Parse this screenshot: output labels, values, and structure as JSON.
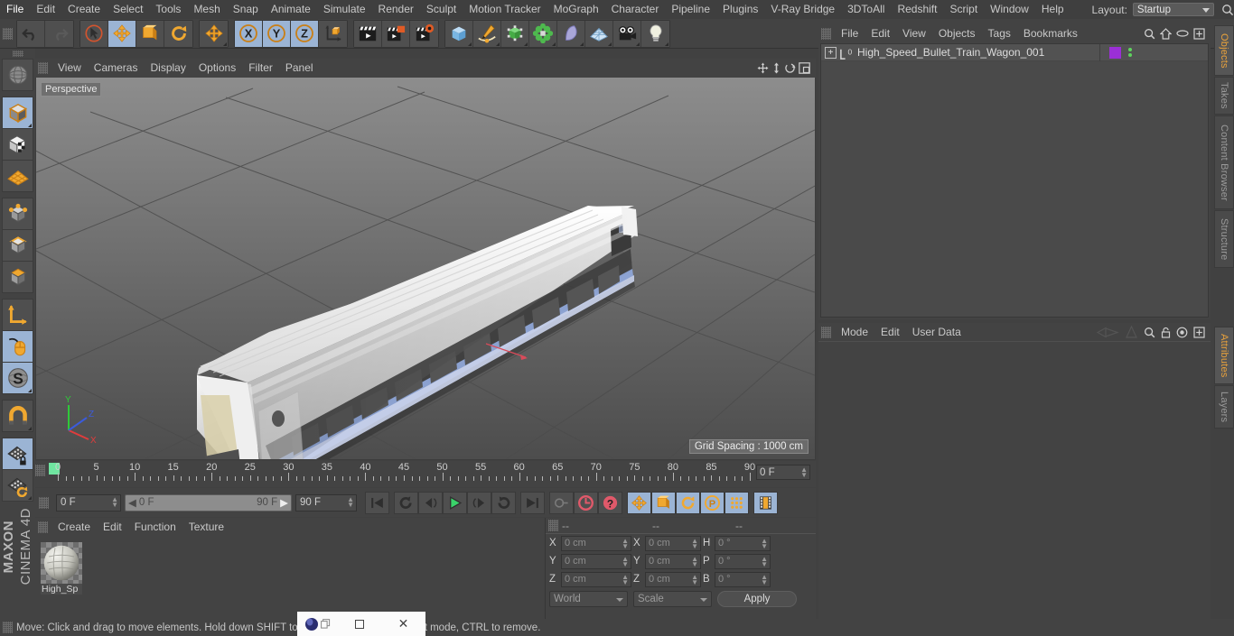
{
  "app": {
    "name": "Cinema 4D",
    "brand_top": "MAXON",
    "brand_bottom": "CINEMA 4D"
  },
  "main_menu": {
    "items": [
      "File",
      "Edit",
      "Create",
      "Select",
      "Tools",
      "Mesh",
      "Snap",
      "Animate",
      "Simulate",
      "Render",
      "Sculpt",
      "Motion Tracker",
      "MoGraph",
      "Character",
      "Pipeline",
      "Plugins",
      "V-Ray Bridge",
      "3DToAll",
      "Redshift",
      "Script",
      "Window",
      "Help"
    ],
    "layout_label": "Layout:",
    "layout_value": "Startup",
    "search_icon": "search-icon"
  },
  "toolbar": {
    "groups": [
      {
        "name": "history",
        "buttons": [
          {
            "name": "undo-button",
            "icon": "undo-arrow-icon",
            "selected": false,
            "corner": false
          },
          {
            "name": "redo-button",
            "icon": "redo-arrow-icon",
            "selected": false,
            "corner": false
          }
        ]
      },
      {
        "name": "tools",
        "buttons": [
          {
            "name": "live-selection-tool",
            "icon": "cursor-circle-icon",
            "selected": false,
            "corner": false
          },
          {
            "name": "move-tool",
            "icon": "move-arrows-icon",
            "selected": true,
            "corner": false
          },
          {
            "name": "scale-tool",
            "icon": "scale-box-icon",
            "selected": false,
            "corner": false
          },
          {
            "name": "rotate-tool",
            "icon": "rotate-circle-icon",
            "selected": false,
            "corner": false
          }
        ]
      },
      {
        "name": "move-dup",
        "buttons": [
          {
            "name": "move-duplicate-tool",
            "icon": "move-arrows-icon",
            "selected": false,
            "corner": true
          }
        ]
      },
      {
        "name": "axis-locks",
        "buttons": [
          {
            "name": "x-axis-lock",
            "icon": "letter-x-icon",
            "selected": true,
            "corner": false
          },
          {
            "name": "y-axis-lock",
            "icon": "letter-y-icon",
            "selected": true,
            "corner": false
          },
          {
            "name": "z-axis-lock",
            "icon": "letter-z-icon",
            "selected": true,
            "corner": false
          },
          {
            "name": "world-object-coordinate-toggle",
            "icon": "axis-cube-icon",
            "selected": false,
            "corner": false
          }
        ]
      },
      {
        "name": "render",
        "buttons": [
          {
            "name": "render-view-button",
            "icon": "clapboard-icon",
            "selected": false,
            "corner": false
          },
          {
            "name": "render-to-picture-viewer-button",
            "icon": "clapboard-square-icon",
            "selected": false,
            "corner": false
          },
          {
            "name": "render-settings-button",
            "icon": "clapboard-gear-icon",
            "selected": false,
            "corner": false
          }
        ]
      },
      {
        "name": "create",
        "buttons": [
          {
            "name": "cube-primitive-button",
            "icon": "blue-cube-icon",
            "selected": false,
            "corner": true
          },
          {
            "name": "spline-pen-button",
            "icon": "pen-spline-icon",
            "selected": false,
            "corner": true
          },
          {
            "name": "nurbs-generator-button",
            "icon": "green-cube-icon",
            "selected": false,
            "corner": true
          },
          {
            "name": "array-modeling-button",
            "icon": "green-cluster-icon",
            "selected": false,
            "corner": true
          },
          {
            "name": "bend-deformer-button",
            "icon": "purple-deformer-icon",
            "selected": false,
            "corner": true
          },
          {
            "name": "floor-environment-button",
            "icon": "floor-grid-icon",
            "selected": false,
            "corner": true
          },
          {
            "name": "camera-button",
            "icon": "camera-icon",
            "selected": false,
            "corner": true
          },
          {
            "name": "light-button",
            "icon": "lightbulb-icon",
            "selected": false,
            "corner": true
          }
        ]
      }
    ]
  },
  "left_toolbar": {
    "buttons": [
      {
        "name": "tool-make-editable",
        "icon": "wireframe-sphere-icon",
        "selected": false,
        "corner": false
      },
      {
        "name": "tool-model-mode",
        "icon": "gray-cube-icon",
        "selected": true,
        "corner": true
      },
      {
        "name": "tool-texture-mode",
        "icon": "checker-cube-icon",
        "selected": false,
        "corner": false
      },
      {
        "name": "tool-workplane-mode",
        "icon": "orange-grid-icon",
        "selected": false,
        "corner": false
      },
      {
        "name": "tool-points-mode",
        "icon": "points-cube-icon",
        "selected": false,
        "corner": false
      },
      {
        "name": "tool-edges-mode",
        "icon": "edges-cube-icon",
        "selected": false,
        "corner": false
      },
      {
        "name": "tool-polygons-mode",
        "icon": "polygon-cube-icon",
        "selected": false,
        "corner": false
      },
      {
        "name": "tool-axis-mode",
        "icon": "axis-corner-icon",
        "selected": false,
        "corner": false
      },
      {
        "name": "tool-enable-axis",
        "icon": "mouse-icon",
        "selected": true,
        "corner": false
      },
      {
        "name": "tool-soft-selection",
        "icon": "s-sphere-icon",
        "selected": true,
        "corner": true
      },
      {
        "name": "tool-snap-toggle",
        "icon": "magnet-icon",
        "selected": false,
        "corner": true
      },
      {
        "name": "tool-workplane-lock",
        "icon": "grid-lock-icon",
        "selected": true,
        "corner": false
      },
      {
        "name": "tool-workplane-rotate",
        "icon": "grid-rotate-icon",
        "selected": false,
        "corner": true
      }
    ]
  },
  "viewport": {
    "menu": [
      "View",
      "Cameras",
      "Display",
      "Options",
      "Filter",
      "Panel"
    ],
    "right_icons": [
      "pan-icon",
      "dolly-icon",
      "rotate-icon",
      "maximize-icon"
    ],
    "perspective_label": "Perspective",
    "grid_label": "Grid Spacing : 1000 cm",
    "axis_gizmo": {
      "x": "X",
      "y": "Y",
      "z": "Z"
    },
    "scene_object": "High_Speed_Bullet_Train_Wagon_001"
  },
  "timeline": {
    "tick_labels": [
      "0",
      "5",
      "10",
      "15",
      "20",
      "25",
      "30",
      "35",
      "40",
      "45",
      "50",
      "55",
      "60",
      "65",
      "70",
      "75",
      "80",
      "85",
      "90"
    ],
    "min_frame": 0,
    "max_frame": 90,
    "current_frame_display": "0 F",
    "marker_frame": 0
  },
  "transport": {
    "current_frame": "0 F",
    "range_start": "0 F",
    "range_end": "90 F",
    "end_frame": "90 F",
    "buttons": [
      {
        "name": "go-to-start-button",
        "icon": "skip-start-icon",
        "selected": false
      },
      {
        "name": "play-backwards-loop-button",
        "icon": "loop-back-icon",
        "selected": false
      },
      {
        "name": "previous-frame-button",
        "icon": "step-back-icon",
        "selected": false
      },
      {
        "name": "play-button",
        "icon": "play-icon",
        "selected": false
      },
      {
        "name": "next-frame-button",
        "icon": "step-forward-icon",
        "selected": false
      },
      {
        "name": "play-forwards-loop-button",
        "icon": "loop-forward-icon",
        "selected": false
      },
      {
        "name": "go-to-end-button",
        "icon": "skip-end-icon",
        "selected": false
      },
      {
        "name": "record-active-objects-button",
        "icon": "key-icon",
        "selected": false
      },
      {
        "name": "autokeying-button",
        "icon": "red-circle-arrow-icon",
        "selected": false
      },
      {
        "name": "keyframe-selection-button",
        "icon": "red-question-icon",
        "selected": false
      },
      {
        "name": "record-position-button",
        "icon": "position-arrows-icon",
        "selected": true
      },
      {
        "name": "record-scale-button",
        "icon": "scale-icon",
        "selected": true
      },
      {
        "name": "record-rotation-button",
        "icon": "rotation-icon",
        "selected": true
      },
      {
        "name": "record-parameter-button",
        "icon": "p-circle-icon",
        "selected": true
      },
      {
        "name": "record-pla-button",
        "icon": "point-dots-icon",
        "selected": true
      },
      {
        "name": "timeline-toggle-button",
        "icon": "filmstrip-icon",
        "selected": true
      }
    ]
  },
  "material_manager": {
    "menu": [
      "Create",
      "Edit",
      "Function",
      "Texture"
    ],
    "materials": [
      {
        "name": "High_Sp",
        "thumb": "sphere-material-icon"
      }
    ]
  },
  "coordinates": {
    "header": [
      "--",
      "--",
      "--"
    ],
    "rows": [
      {
        "pos_axis": "X",
        "pos_value": "0 cm",
        "size_axis": "X",
        "size_value": "0 cm",
        "rot_axis": "H",
        "rot_value": "0 °"
      },
      {
        "pos_axis": "Y",
        "pos_value": "0 cm",
        "size_axis": "Y",
        "size_value": "0 cm",
        "rot_axis": "P",
        "rot_value": "0 °"
      },
      {
        "pos_axis": "Z",
        "pos_value": "0 cm",
        "size_axis": "Z",
        "size_value": "0 cm",
        "rot_axis": "B",
        "rot_value": "0 °"
      }
    ],
    "coord_system": "World",
    "transform_mode": "Scale",
    "apply_label": "Apply"
  },
  "object_manager": {
    "menu": [
      "File",
      "Edit",
      "View",
      "Objects",
      "Tags",
      "Bookmarks"
    ],
    "right_icons": [
      "search-icon",
      "home-icon",
      "ellipse-icon",
      "fit-icon"
    ],
    "rows": [
      {
        "name": "High_Speed_Bullet_Train_Wagon_001",
        "icon": "null-object-icon",
        "expander": "+",
        "tag_color": "#9b2fd6",
        "dot_color": "#5ed45e"
      }
    ]
  },
  "attributes_manager": {
    "menu": [
      "Mode",
      "Edit",
      "User Data"
    ],
    "right_icons": [
      "back-arrow-icon",
      "forward-arrow-icon",
      "search-icon",
      "lock-icon",
      "target-icon",
      "fit-icon"
    ]
  },
  "right_tabs": {
    "upper": [
      {
        "label": "Objects",
        "active": true
      },
      {
        "label": "Takes",
        "active": false
      },
      {
        "label": "Content Browser",
        "active": false
      },
      {
        "label": "Structure",
        "active": false
      }
    ],
    "lower": [
      {
        "label": "Attributes",
        "active": true
      },
      {
        "label": "Layers",
        "active": false
      }
    ]
  },
  "status_bar": {
    "text_before": "Move: Click and drag to move elements. Hold down SHIFT t",
    "text_after": "to the selection in point mode, CTRL to remove.",
    "full_text": "Move: Click and drag to move elements. Hold down SHIFT to add to the selection in point mode, CTRL to remove."
  },
  "overlay_window": {
    "icon": "c4d-app-icon",
    "restore_label": "□",
    "close_label": "✕"
  },
  "colors": {
    "panel_bg": "#434343",
    "accent_orange": "#e8a13c",
    "selected_blue": "#9bb4d4",
    "tool_orange": "#f0a830",
    "green_marker": "#6fe6a0",
    "record_red": "#e0596a"
  }
}
